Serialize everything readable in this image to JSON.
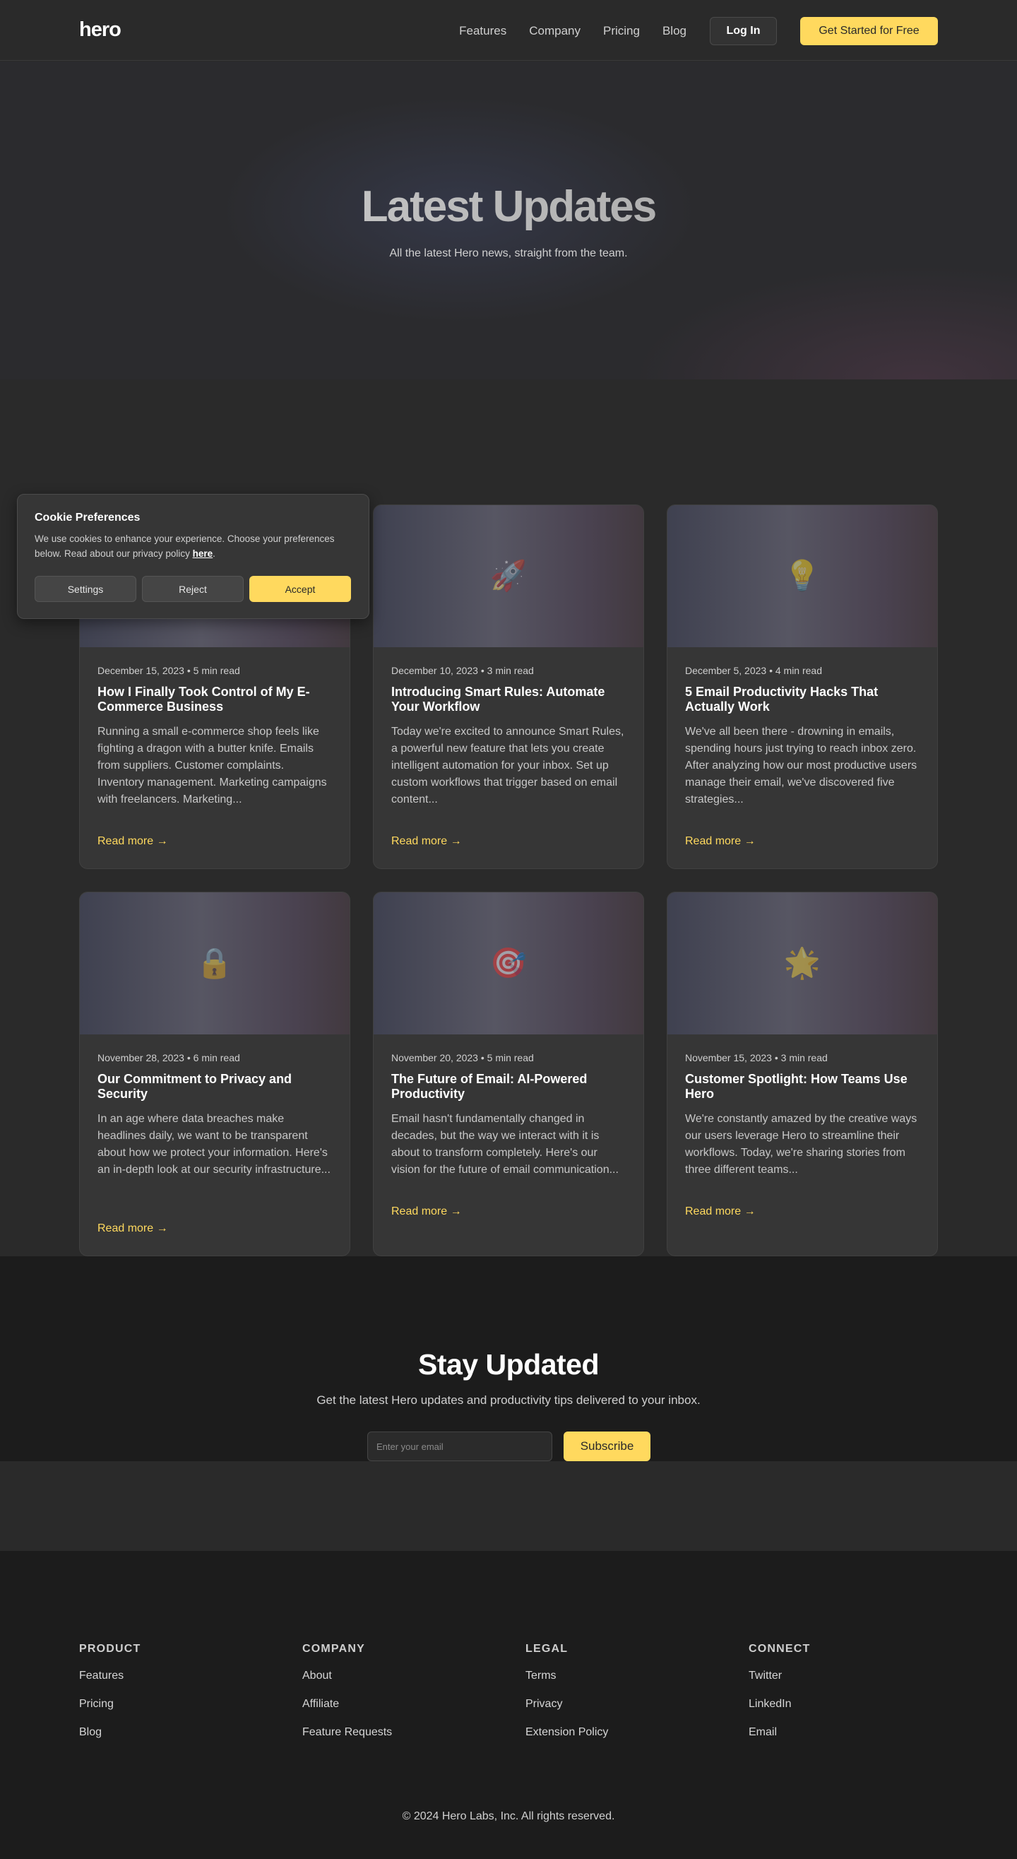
{
  "header": {
    "logo": "hero",
    "nav": [
      "Features",
      "Company",
      "Pricing",
      "Blog"
    ],
    "login_label": "Log In",
    "cta_label": "Get Started for Free"
  },
  "hero": {
    "title": "Latest Updates",
    "subtitle": "All the latest Hero news, straight from the team."
  },
  "cookie": {
    "title": "Cookie Preferences",
    "text": "We use cookies to enhance your experience. Choose your preferences below. Read about our privacy policy ",
    "link_label": "here",
    "text_end": ".",
    "settings_label": "Settings",
    "reject_label": "Reject",
    "accept_label": "Accept"
  },
  "posts": [
    {
      "icon": "rocket-icon",
      "glyph": "🚀",
      "meta": "December 15, 2023 • 5 min read",
      "title": "How I Finally Took Control of My E-Commerce Business",
      "excerpt": "Running a small e-commerce shop feels like fighting a dragon with a butter knife. Emails from suppliers. Customer complaints. Inventory management. Marketing campaigns with freelancers. Marketing...",
      "link": "Read more →"
    },
    {
      "icon": "rocket-icon",
      "glyph": "🚀",
      "meta": "December 10, 2023 • 3 min read",
      "title": "Introducing Smart Rules: Automate Your Workflow",
      "excerpt": "Today we're excited to announce Smart Rules, a powerful new feature that lets you create intelligent automation for your inbox. Set up custom workflows that trigger based on email content...",
      "link": "Read more →"
    },
    {
      "icon": "lightbulb-icon",
      "glyph": "💡",
      "meta": "December 5, 2023 • 4 min read",
      "title": "5 Email Productivity Hacks That Actually Work",
      "excerpt": "We've all been there - drowning in emails, spending hours just trying to reach inbox zero. After analyzing how our most productive users manage their email, we've discovered five strategies...",
      "link": "Read more →"
    },
    {
      "icon": "lock-icon",
      "glyph": "🔒",
      "meta": "November 28, 2023 • 6 min read",
      "title": "Our Commitment to Privacy and Security",
      "excerpt": "In an age where data breaches make headlines daily, we want to be transparent about how we protect your information. Here's an in-depth look at our security infrastructure...",
      "link": "Read more →"
    },
    {
      "icon": "target-icon",
      "glyph": "🎯",
      "meta": "November 20, 2023 • 5 min read",
      "title": "The Future of Email: AI-Powered Productivity",
      "excerpt": "Email hasn't fundamentally changed in decades, but the way we interact with it is about to transform completely. Here's our vision for the future of email communication...",
      "link": "Read more →"
    },
    {
      "icon": "star-icon",
      "glyph": "🌟",
      "meta": "November 15, 2023 • 3 min read",
      "title": "Customer Spotlight: How Teams Use Hero",
      "excerpt": "We're constantly amazed by the creative ways our users leverage Hero to streamline their workflows. Today, we're sharing stories from three different teams...",
      "link": "Read more →"
    }
  ],
  "newsletter": {
    "title": "Stay Updated",
    "subtitle": "Get the latest Hero updates and productivity tips delivered to your inbox.",
    "placeholder": "Enter your email",
    "button": "Subscribe"
  },
  "footer": {
    "columns": [
      {
        "heading": "PRODUCT",
        "links": [
          "Features",
          "Pricing",
          "Blog"
        ]
      },
      {
        "heading": "COMPANY",
        "links": [
          "About",
          "Affiliate",
          "Feature Requests"
        ]
      },
      {
        "heading": "LEGAL",
        "links": [
          "Terms",
          "Privacy",
          "Extension Policy"
        ]
      },
      {
        "heading": "CONNECT",
        "links": [
          "Twitter",
          "LinkedIn",
          "Email"
        ]
      }
    ],
    "copyright": "© 2024 Hero Labs, Inc. All rights reserved."
  },
  "colors": {
    "accent": "#ffd95e",
    "background": "#2a2a2a",
    "footer": "#1c1c1c",
    "card": "#363636"
  }
}
